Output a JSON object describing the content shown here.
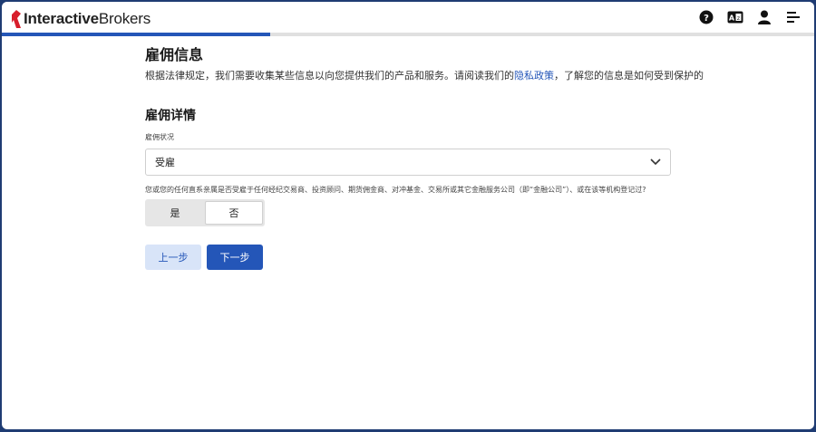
{
  "brand": {
    "name_bold": "Interactive",
    "name_regular": "Brokers",
    "accent": "#d81e2b"
  },
  "header": {
    "icons": [
      "help-icon",
      "language-icon",
      "user-icon",
      "menu-icon"
    ]
  },
  "progress": {
    "fraction": 0.33,
    "color": "#2456b8"
  },
  "page": {
    "title": "雇佣信息",
    "intro_before": "根据法律规定，我们需要收集某些信息以向您提供我们的产品和服务。请阅读我们的",
    "intro_link": "隐私政策",
    "intro_after": "，了解您的信息是如何受到保护的"
  },
  "section": {
    "title": "雇佣详情",
    "employment_label": "雇佣状况",
    "employment_value": "受雇",
    "question": "您或您的任何直系亲属是否受雇于任何经纪交易商、投资顾问、期货佣金商、对冲基金、交易所或其它金融服务公司（即“金融公司”）、或在该等机构登记过?",
    "toggle": {
      "yes": "是",
      "no": "否",
      "selected": "no"
    }
  },
  "buttons": {
    "prev": "上一步",
    "next": "下一步"
  }
}
